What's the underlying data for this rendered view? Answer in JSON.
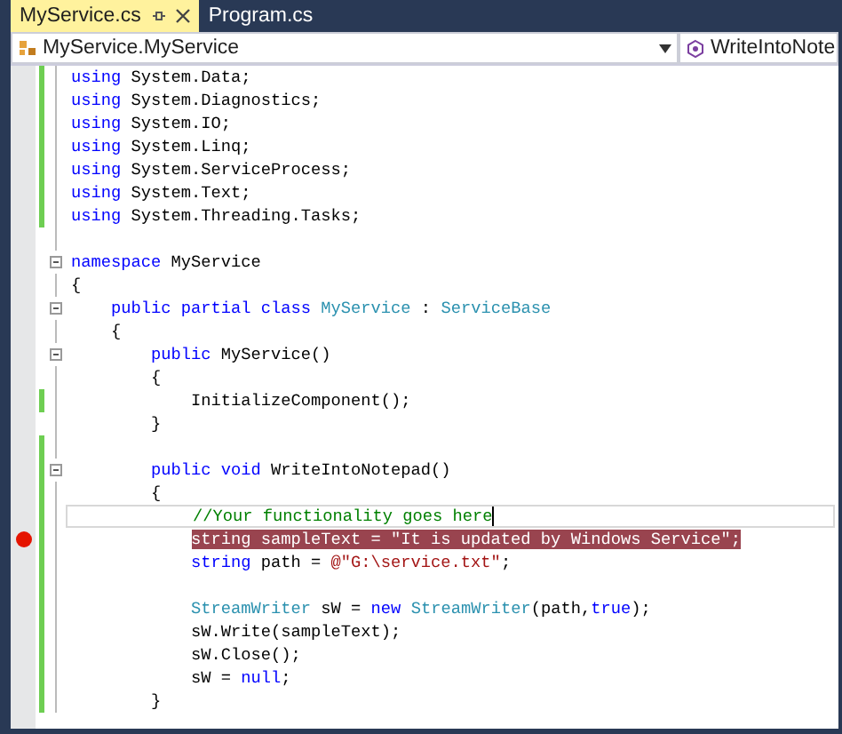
{
  "tabs": [
    {
      "label": "MyService.cs",
      "selected": true
    },
    {
      "label": "Program.cs",
      "selected": false
    }
  ],
  "navigation_bar": {
    "type_dropdown": "MyService.MyService",
    "member_dropdown": "WriteIntoNote"
  },
  "lines": [
    {
      "changed": true,
      "fold": false,
      "breakpoint": false,
      "current": false,
      "segments": [
        {
          "kind": "keyword",
          "text": "using"
        },
        {
          "kind": "plain",
          "text": " System.Data;"
        }
      ]
    },
    {
      "changed": true,
      "fold": false,
      "breakpoint": false,
      "current": false,
      "segments": [
        {
          "kind": "keyword",
          "text": "using"
        },
        {
          "kind": "plain",
          "text": " System.Diagnostics;"
        }
      ]
    },
    {
      "changed": true,
      "fold": false,
      "breakpoint": false,
      "current": false,
      "segments": [
        {
          "kind": "keyword",
          "text": "using"
        },
        {
          "kind": "plain",
          "text": " System.IO;"
        }
      ]
    },
    {
      "changed": true,
      "fold": false,
      "breakpoint": false,
      "current": false,
      "segments": [
        {
          "kind": "keyword",
          "text": "using"
        },
        {
          "kind": "plain",
          "text": " System.Linq;"
        }
      ]
    },
    {
      "changed": true,
      "fold": false,
      "breakpoint": false,
      "current": false,
      "segments": [
        {
          "kind": "keyword",
          "text": "using"
        },
        {
          "kind": "plain",
          "text": " System.ServiceProcess;"
        }
      ]
    },
    {
      "changed": true,
      "fold": false,
      "breakpoint": false,
      "current": false,
      "segments": [
        {
          "kind": "keyword",
          "text": "using"
        },
        {
          "kind": "plain",
          "text": " System.Text;"
        }
      ]
    },
    {
      "changed": true,
      "fold": false,
      "breakpoint": false,
      "current": false,
      "segments": [
        {
          "kind": "keyword",
          "text": "using"
        },
        {
          "kind": "plain",
          "text": " System.Threading.Tasks;"
        }
      ]
    },
    {
      "changed": false,
      "fold": false,
      "breakpoint": false,
      "current": false
    },
    {
      "changed": false,
      "fold": true,
      "breakpoint": false,
      "current": false,
      "segments": [
        {
          "kind": "keyword",
          "text": "namespace"
        },
        {
          "kind": "plain",
          "text": " MyService"
        }
      ]
    },
    {
      "changed": false,
      "fold": false,
      "breakpoint": false,
      "current": false,
      "segments": [
        {
          "kind": "plain",
          "text": "{"
        }
      ]
    },
    {
      "changed": false,
      "fold": true,
      "breakpoint": false,
      "current": false,
      "segments": [
        {
          "kind": "keyword",
          "text": "    public partial class "
        },
        {
          "kind": "type",
          "text": "MyService"
        },
        {
          "kind": "plain",
          "text": " : "
        },
        {
          "kind": "type",
          "text": "ServiceBase"
        }
      ]
    },
    {
      "changed": false,
      "fold": false,
      "breakpoint": false,
      "current": false,
      "segments": [
        {
          "kind": "plain",
          "text": "    {"
        }
      ]
    },
    {
      "changed": false,
      "fold": true,
      "breakpoint": false,
      "current": false,
      "segments": [
        {
          "kind": "keyword",
          "text": "        public"
        },
        {
          "kind": "plain",
          "text": " MyService()"
        }
      ]
    },
    {
      "changed": false,
      "fold": false,
      "breakpoint": false,
      "current": false,
      "segments": [
        {
          "kind": "plain",
          "text": "        {"
        }
      ]
    },
    {
      "changed": true,
      "fold": false,
      "breakpoint": false,
      "current": false,
      "segments": [
        {
          "kind": "plain",
          "text": "            InitializeComponent();"
        }
      ]
    },
    {
      "changed": false,
      "fold": false,
      "breakpoint": false,
      "current": false,
      "segments": [
        {
          "kind": "plain",
          "text": "        }"
        }
      ]
    },
    {
      "changed": true,
      "fold": false,
      "breakpoint": false,
      "current": false
    },
    {
      "changed": true,
      "fold": true,
      "breakpoint": false,
      "current": false,
      "segments": [
        {
          "kind": "keyword",
          "text": "        public void"
        },
        {
          "kind": "plain",
          "text": " WriteIntoNotepad()"
        }
      ]
    },
    {
      "changed": true,
      "fold": false,
      "breakpoint": false,
      "current": false,
      "segments": [
        {
          "kind": "plain",
          "text": "        {"
        }
      ]
    },
    {
      "changed": true,
      "fold": false,
      "breakpoint": false,
      "current": true,
      "segments": [
        {
          "kind": "comment",
          "text": "            //Your functionality goes here"
        }
      ]
    },
    {
      "changed": true,
      "fold": false,
      "breakpoint": true,
      "current": false,
      "segments": [
        {
          "kind": "keyword",
          "text": "            string"
        },
        {
          "kind": "plain",
          "text": " sampleText = "
        },
        {
          "kind": "string",
          "text": "\"It is updated by Windows Service\""
        },
        {
          "kind": "plain",
          "text": ";"
        }
      ]
    },
    {
      "changed": true,
      "fold": false,
      "breakpoint": false,
      "current": false,
      "segments": [
        {
          "kind": "keyword",
          "text": "            string"
        },
        {
          "kind": "plain",
          "text": " path = "
        },
        {
          "kind": "string",
          "text": "@\"G:\\service.txt\""
        },
        {
          "kind": "plain",
          "text": ";"
        }
      ]
    },
    {
      "changed": true,
      "fold": false,
      "breakpoint": false,
      "current": false
    },
    {
      "changed": true,
      "fold": false,
      "breakpoint": false,
      "current": false,
      "segments": [
        {
          "kind": "type",
          "text": "            StreamWriter"
        },
        {
          "kind": "plain",
          "text": " sW = "
        },
        {
          "kind": "keyword",
          "text": "new "
        },
        {
          "kind": "type",
          "text": "StreamWriter"
        },
        {
          "kind": "plain",
          "text": "(path,"
        },
        {
          "kind": "keyword",
          "text": "true"
        },
        {
          "kind": "plain",
          "text": ");"
        }
      ]
    },
    {
      "changed": true,
      "fold": false,
      "breakpoint": false,
      "current": false,
      "segments": [
        {
          "kind": "plain",
          "text": "            sW.Write(sampleText);"
        }
      ]
    },
    {
      "changed": true,
      "fold": false,
      "breakpoint": false,
      "current": false,
      "segments": [
        {
          "kind": "plain",
          "text": "            sW.Close();"
        }
      ]
    },
    {
      "changed": true,
      "fold": false,
      "breakpoint": false,
      "current": false,
      "segments": [
        {
          "kind": "plain",
          "text": "            sW = "
        },
        {
          "kind": "keyword",
          "text": "null"
        },
        {
          "kind": "plain",
          "text": ";"
        }
      ]
    },
    {
      "changed": true,
      "fold": false,
      "breakpoint": false,
      "current": false,
      "segments": [
        {
          "kind": "plain",
          "text": "        }"
        }
      ]
    }
  ]
}
